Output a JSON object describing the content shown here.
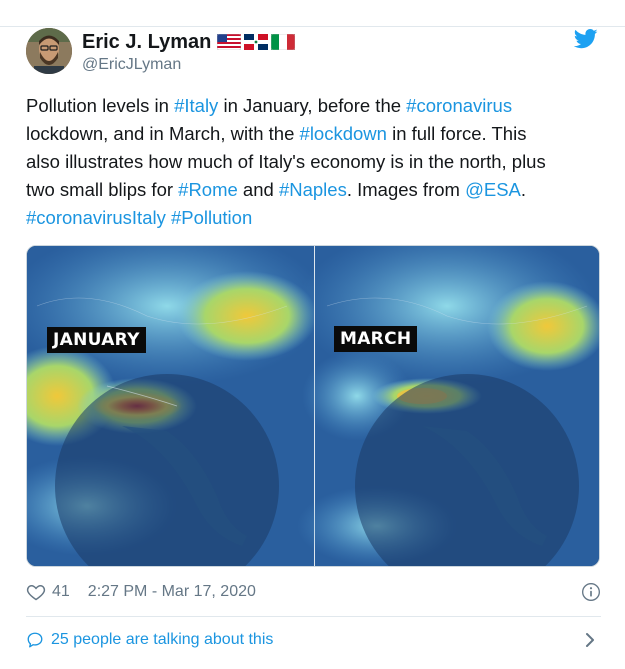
{
  "author": {
    "display_name": "Eric J. Lyman",
    "handle": "@EricJLyman",
    "flags": [
      "us-flag",
      "dominican-republic-flag",
      "italy-flag"
    ]
  },
  "tweet": {
    "segments": [
      {
        "text": "Pollution levels in ",
        "link": false
      },
      {
        "text": "#Italy",
        "link": true
      },
      {
        "text": " in January, before the ",
        "link": false
      },
      {
        "text": "#coronavirus",
        "link": true
      },
      {
        "text": "\nlockdown, and in March, with the ",
        "link": false
      },
      {
        "text": "#lockdown",
        "link": true
      },
      {
        "text": " in full force. This\nalso illustrates how much of Italy's economy is in the north, plus\ntwo small blips for ",
        "link": false
      },
      {
        "text": "#Rome",
        "link": true
      },
      {
        "text": " and ",
        "link": false
      },
      {
        "text": "#Naples",
        "link": true
      },
      {
        "text": ". Images from ",
        "link": false
      },
      {
        "text": "@ESA",
        "link": true
      },
      {
        "text": ".\n",
        "link": false
      },
      {
        "text": "#coronavirusItaly",
        "link": true
      },
      {
        "text": " ",
        "link": false
      },
      {
        "text": "#Pollution",
        "link": true
      }
    ]
  },
  "media": {
    "left_label": "JANUARY",
    "right_label": "MARCH"
  },
  "meta": {
    "like_count": "41",
    "timestamp": "2:27 PM - Mar 17, 2020"
  },
  "footer": {
    "talking_label": "25 people are talking about this"
  },
  "colors": {
    "link": "#1b95e0",
    "secondary_text": "#657786",
    "twitter_blue": "#1da1f2"
  }
}
